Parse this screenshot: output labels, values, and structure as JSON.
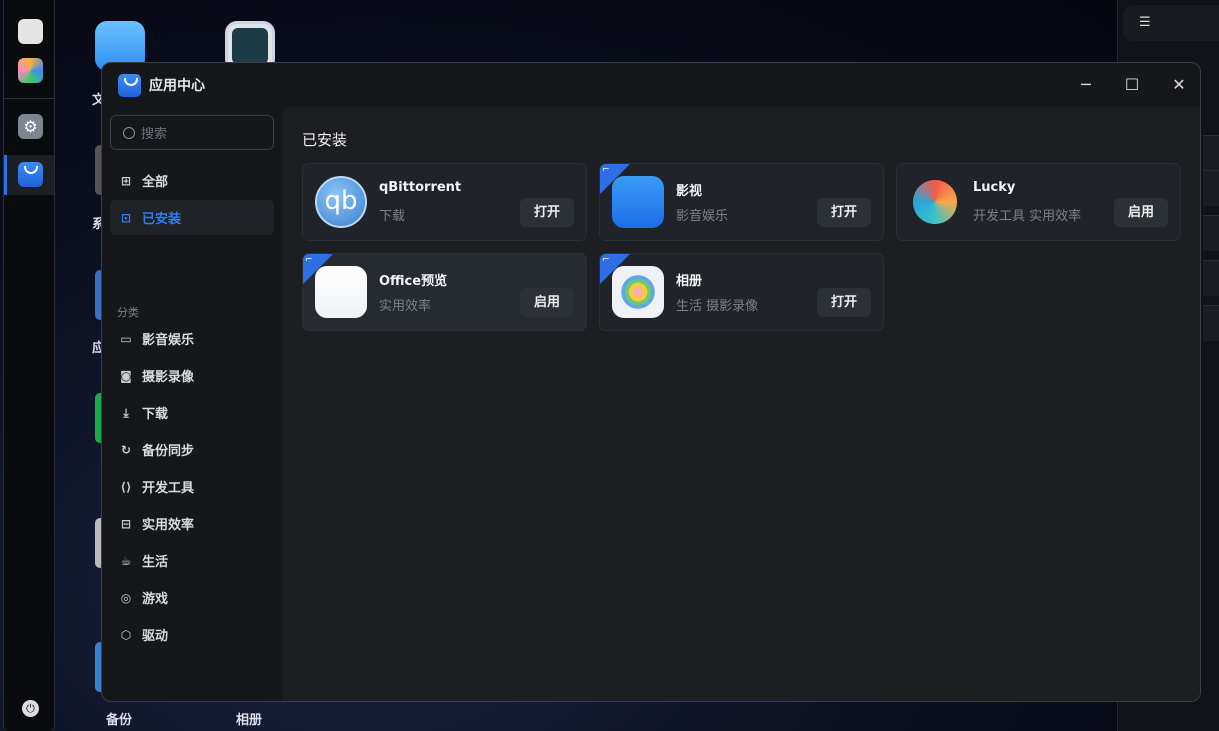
{
  "desktop": {
    "labels": [
      "文",
      "系",
      "应",
      "备份",
      "相册"
    ]
  },
  "dock": {
    "items": [
      "monitor-icon",
      "apps-icon",
      "settings-icon",
      "store-icon"
    ],
    "active": "应用中心"
  },
  "window": {
    "title": "应用中心",
    "controls": {
      "minimize": "─",
      "maximize": "☐",
      "close": "✕"
    }
  },
  "sidebar": {
    "search_placeholder": "搜索",
    "all": "全部",
    "installed": "已安装",
    "category_heading": "分类",
    "categories": [
      {
        "label": "影音娱乐",
        "icon": "▭"
      },
      {
        "label": "摄影录像",
        "icon": "◙"
      },
      {
        "label": "下载",
        "icon": "⤓"
      },
      {
        "label": "备份同步",
        "icon": "↻"
      },
      {
        "label": "开发工具",
        "icon": "⟨⟩"
      },
      {
        "label": "实用效率",
        "icon": "⊟"
      },
      {
        "label": "生活",
        "icon": "☕"
      },
      {
        "label": "游戏",
        "icon": "◎"
      },
      {
        "label": "驱动",
        "icon": "⬡"
      }
    ]
  },
  "main": {
    "heading": "已安装",
    "apps": [
      {
        "name": "qBittorrent",
        "tags": "下载",
        "action": "打开",
        "badge": false
      },
      {
        "name": "影视",
        "tags": "影音娱乐",
        "action": "打开",
        "badge": true
      },
      {
        "name": "Lucky",
        "tags": "开发工具 实用效率",
        "action": "启用",
        "badge": false
      },
      {
        "name": "Office预览",
        "tags": "实用效率",
        "action": "启用",
        "badge": true
      },
      {
        "name": "相册",
        "tags": "生活 摄影录像",
        "action": "打开",
        "badge": true
      }
    ]
  },
  "colors": {
    "accent": "#2f7ff0",
    "badge": "#2f6fe6"
  }
}
